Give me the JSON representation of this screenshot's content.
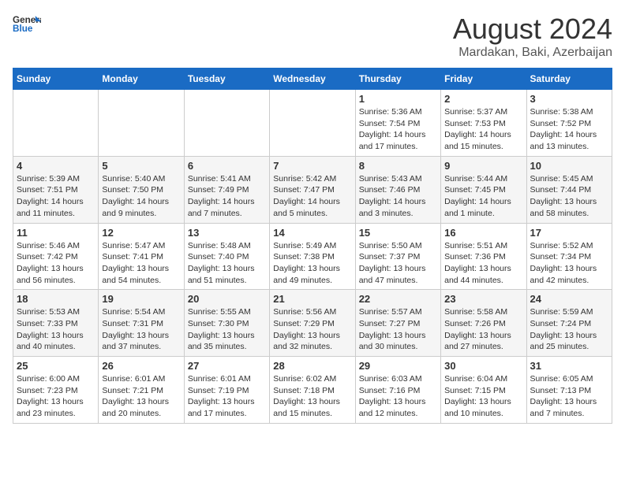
{
  "header": {
    "logo_general": "General",
    "logo_blue": "Blue",
    "month_year": "August 2024",
    "location": "Mardakan, Baki, Azerbaijan"
  },
  "days_of_week": [
    "Sunday",
    "Monday",
    "Tuesday",
    "Wednesday",
    "Thursday",
    "Friday",
    "Saturday"
  ],
  "weeks": [
    [
      {
        "day": "",
        "info": ""
      },
      {
        "day": "",
        "info": ""
      },
      {
        "day": "",
        "info": ""
      },
      {
        "day": "",
        "info": ""
      },
      {
        "day": "1",
        "info": "Sunrise: 5:36 AM\nSunset: 7:54 PM\nDaylight: 14 hours\nand 17 minutes."
      },
      {
        "day": "2",
        "info": "Sunrise: 5:37 AM\nSunset: 7:53 PM\nDaylight: 14 hours\nand 15 minutes."
      },
      {
        "day": "3",
        "info": "Sunrise: 5:38 AM\nSunset: 7:52 PM\nDaylight: 14 hours\nand 13 minutes."
      }
    ],
    [
      {
        "day": "4",
        "info": "Sunrise: 5:39 AM\nSunset: 7:51 PM\nDaylight: 14 hours\nand 11 minutes."
      },
      {
        "day": "5",
        "info": "Sunrise: 5:40 AM\nSunset: 7:50 PM\nDaylight: 14 hours\nand 9 minutes."
      },
      {
        "day": "6",
        "info": "Sunrise: 5:41 AM\nSunset: 7:49 PM\nDaylight: 14 hours\nand 7 minutes."
      },
      {
        "day": "7",
        "info": "Sunrise: 5:42 AM\nSunset: 7:47 PM\nDaylight: 14 hours\nand 5 minutes."
      },
      {
        "day": "8",
        "info": "Sunrise: 5:43 AM\nSunset: 7:46 PM\nDaylight: 14 hours\nand 3 minutes."
      },
      {
        "day": "9",
        "info": "Sunrise: 5:44 AM\nSunset: 7:45 PM\nDaylight: 14 hours\nand 1 minute."
      },
      {
        "day": "10",
        "info": "Sunrise: 5:45 AM\nSunset: 7:44 PM\nDaylight: 13 hours\nand 58 minutes."
      }
    ],
    [
      {
        "day": "11",
        "info": "Sunrise: 5:46 AM\nSunset: 7:42 PM\nDaylight: 13 hours\nand 56 minutes."
      },
      {
        "day": "12",
        "info": "Sunrise: 5:47 AM\nSunset: 7:41 PM\nDaylight: 13 hours\nand 54 minutes."
      },
      {
        "day": "13",
        "info": "Sunrise: 5:48 AM\nSunset: 7:40 PM\nDaylight: 13 hours\nand 51 minutes."
      },
      {
        "day": "14",
        "info": "Sunrise: 5:49 AM\nSunset: 7:38 PM\nDaylight: 13 hours\nand 49 minutes."
      },
      {
        "day": "15",
        "info": "Sunrise: 5:50 AM\nSunset: 7:37 PM\nDaylight: 13 hours\nand 47 minutes."
      },
      {
        "day": "16",
        "info": "Sunrise: 5:51 AM\nSunset: 7:36 PM\nDaylight: 13 hours\nand 44 minutes."
      },
      {
        "day": "17",
        "info": "Sunrise: 5:52 AM\nSunset: 7:34 PM\nDaylight: 13 hours\nand 42 minutes."
      }
    ],
    [
      {
        "day": "18",
        "info": "Sunrise: 5:53 AM\nSunset: 7:33 PM\nDaylight: 13 hours\nand 40 minutes."
      },
      {
        "day": "19",
        "info": "Sunrise: 5:54 AM\nSunset: 7:31 PM\nDaylight: 13 hours\nand 37 minutes."
      },
      {
        "day": "20",
        "info": "Sunrise: 5:55 AM\nSunset: 7:30 PM\nDaylight: 13 hours\nand 35 minutes."
      },
      {
        "day": "21",
        "info": "Sunrise: 5:56 AM\nSunset: 7:29 PM\nDaylight: 13 hours\nand 32 minutes."
      },
      {
        "day": "22",
        "info": "Sunrise: 5:57 AM\nSunset: 7:27 PM\nDaylight: 13 hours\nand 30 minutes."
      },
      {
        "day": "23",
        "info": "Sunrise: 5:58 AM\nSunset: 7:26 PM\nDaylight: 13 hours\nand 27 minutes."
      },
      {
        "day": "24",
        "info": "Sunrise: 5:59 AM\nSunset: 7:24 PM\nDaylight: 13 hours\nand 25 minutes."
      }
    ],
    [
      {
        "day": "25",
        "info": "Sunrise: 6:00 AM\nSunset: 7:23 PM\nDaylight: 13 hours\nand 23 minutes."
      },
      {
        "day": "26",
        "info": "Sunrise: 6:01 AM\nSunset: 7:21 PM\nDaylight: 13 hours\nand 20 minutes."
      },
      {
        "day": "27",
        "info": "Sunrise: 6:01 AM\nSunset: 7:19 PM\nDaylight: 13 hours\nand 17 minutes."
      },
      {
        "day": "28",
        "info": "Sunrise: 6:02 AM\nSunset: 7:18 PM\nDaylight: 13 hours\nand 15 minutes."
      },
      {
        "day": "29",
        "info": "Sunrise: 6:03 AM\nSunset: 7:16 PM\nDaylight: 13 hours\nand 12 minutes."
      },
      {
        "day": "30",
        "info": "Sunrise: 6:04 AM\nSunset: 7:15 PM\nDaylight: 13 hours\nand 10 minutes."
      },
      {
        "day": "31",
        "info": "Sunrise: 6:05 AM\nSunset: 7:13 PM\nDaylight: 13 hours\nand 7 minutes."
      }
    ]
  ]
}
